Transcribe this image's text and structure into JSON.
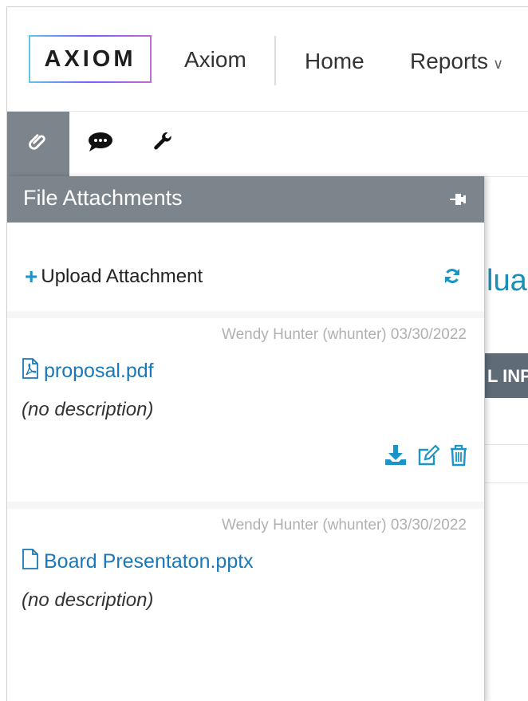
{
  "topnav": {
    "logo_text": "AXIOM",
    "app_name": "Axiom",
    "home_label": "Home",
    "reports_label": "Reports"
  },
  "panel_tabs": [
    {
      "icon": "paperclip-icon",
      "active": true
    },
    {
      "icon": "comments-icon",
      "active": false
    },
    {
      "icon": "wrench-icon",
      "active": false
    }
  ],
  "panel": {
    "title": "File Attachments",
    "upload_label": "Upload Attachment",
    "attachments": [
      {
        "meta": "Wendy Hunter (whunter) 03/30/2022",
        "filename": "proposal.pdf",
        "file_icon": "pdf-file-icon",
        "description": "(no description)"
      },
      {
        "meta": "Wendy Hunter (whunter) 03/30/2022",
        "filename": "Board Presentaton.pptx",
        "file_icon": "file-icon",
        "description": "(no description)"
      }
    ]
  },
  "background": {
    "title_fragment": "lua",
    "tab_fragment": "L INP"
  },
  "colors": {
    "accent": "#1a95c9",
    "link": "#1a78b8",
    "panel_header": "#7c858c"
  }
}
